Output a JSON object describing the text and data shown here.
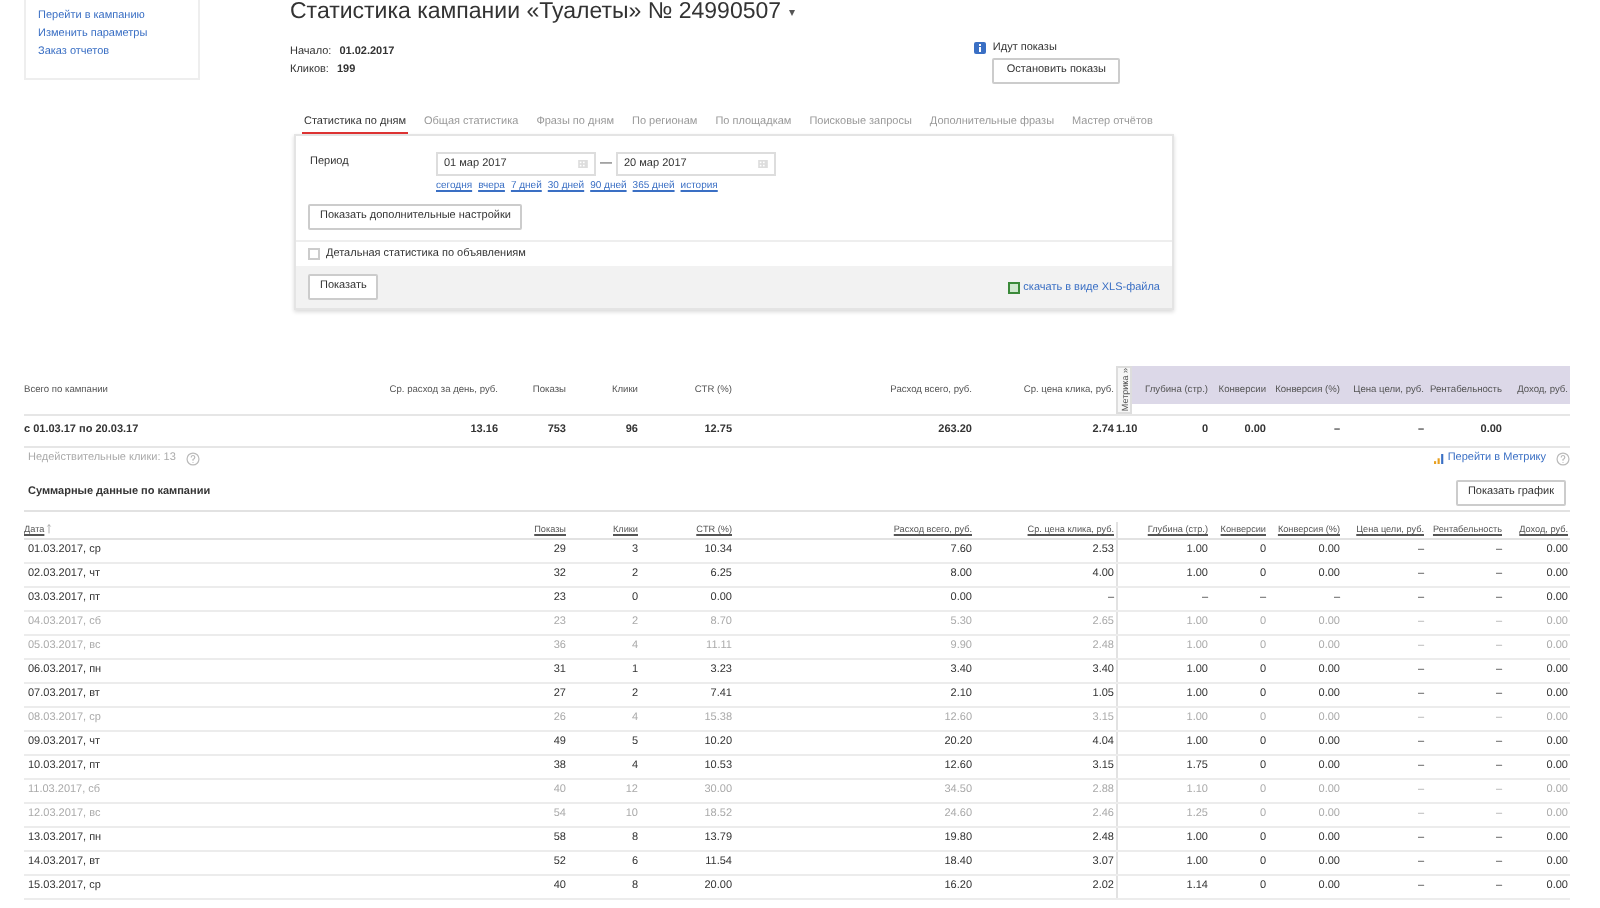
{
  "sidebar": {
    "links": [
      "Перейти в кампанию",
      "Изменить параметры",
      "Заказ отчетов"
    ]
  },
  "title": "Статистика кампании «Туалеты» № 24990507",
  "title_caret": "▾",
  "meta": [
    {
      "label": "Начало:",
      "value": "01.02.2017"
    },
    {
      "label": "Кликов:",
      "value": "199"
    }
  ],
  "status": {
    "text": "Идут показы",
    "button": "Остановить показы"
  },
  "tabs": [
    {
      "label": "Статистика по дням",
      "selected": true
    },
    {
      "label": "Общая статистика",
      "selected": false
    },
    {
      "label": "Фразы по дням",
      "selected": false
    },
    {
      "label": "По регионам",
      "selected": false
    },
    {
      "label": "По площадкам",
      "selected": false
    },
    {
      "label": "Поисковые запросы",
      "selected": false
    },
    {
      "label": "Дополнительные фразы",
      "selected": false
    },
    {
      "label": "Мастер отчётов",
      "selected": false
    }
  ],
  "period": {
    "label": "Период",
    "from": "01 мар 2017",
    "dash": "—",
    "to": "20 мар 2017",
    "quick": [
      "сегодня",
      "вчера",
      "7 дней",
      "30 дней",
      "90 дней",
      "365 дней",
      "история"
    ]
  },
  "settings_button": "Показать дополнительные настройки",
  "detail_checkbox": {
    "label": "Детальная статистика по объявлениям",
    "checked": false
  },
  "show_button": "Показать",
  "xls_link": "скачать в виде XLS-файла",
  "summary": {
    "columns": [
      "Всего по кампании",
      "Ср. расход за день, руб.",
      "Показы",
      "Клики",
      "CTR (%)",
      "Расход всего, руб.",
      "Ср. цена клика, руб.",
      "Глубина (стр.)",
      "Конверсии",
      "Конверсия (%)",
      "Цена цели, руб.",
      "Рентабельность",
      "Доход, руб."
    ],
    "metrica_tab": "Метрика »",
    "values": [
      "с 01.03.17 по 20.03.17",
      "13.16",
      "753",
      "96",
      "12.75",
      "263.20",
      "2.74",
      "1.10",
      "0",
      "0.00",
      "–",
      "–",
      "0.00"
    ]
  },
  "invalid_clicks": "Недействительные клики: 13",
  "metrica_link": "Перейти в Метрику",
  "section_title": "Суммарные данные по кампании",
  "chart_button": "Показать график",
  "table": {
    "columns": [
      "Дата",
      "Показы",
      "Клики",
      "CTR (%)",
      "Расход всего, руб.",
      "Ср. цена клика, руб.",
      "Глубина (стр.)",
      "Конверсии",
      "Конверсия (%)",
      "Цена цели, руб.",
      "Рентабельность",
      "Доход, руб."
    ],
    "rows": [
      {
        "weekend": false,
        "cells": [
          "01.03.2017, ср",
          "29",
          "3",
          "10.34",
          "7.60",
          "2.53",
          "1.00",
          "0",
          "0.00",
          "–",
          "–",
          "0.00"
        ]
      },
      {
        "weekend": false,
        "cells": [
          "02.03.2017, чт",
          "32",
          "2",
          "6.25",
          "8.00",
          "4.00",
          "1.00",
          "0",
          "0.00",
          "–",
          "–",
          "0.00"
        ]
      },
      {
        "weekend": false,
        "cells": [
          "03.03.2017, пт",
          "23",
          "0",
          "0.00",
          "0.00",
          "–",
          "–",
          "–",
          "–",
          "–",
          "–",
          "0.00"
        ]
      },
      {
        "weekend": true,
        "cells": [
          "04.03.2017, сб",
          "23",
          "2",
          "8.70",
          "5.30",
          "2.65",
          "1.00",
          "0",
          "0.00",
          "–",
          "–",
          "0.00"
        ]
      },
      {
        "weekend": true,
        "cells": [
          "05.03.2017, вс",
          "36",
          "4",
          "11.11",
          "9.90",
          "2.48",
          "1.00",
          "0",
          "0.00",
          "–",
          "–",
          "0.00"
        ]
      },
      {
        "weekend": false,
        "cells": [
          "06.03.2017, пн",
          "31",
          "1",
          "3.23",
          "3.40",
          "3.40",
          "1.00",
          "0",
          "0.00",
          "–",
          "–",
          "0.00"
        ]
      },
      {
        "weekend": false,
        "cells": [
          "07.03.2017, вт",
          "27",
          "2",
          "7.41",
          "2.10",
          "1.05",
          "1.00",
          "0",
          "0.00",
          "–",
          "–",
          "0.00"
        ]
      },
      {
        "weekend": true,
        "cells": [
          "08.03.2017, ср",
          "26",
          "4",
          "15.38",
          "12.60",
          "3.15",
          "1.00",
          "0",
          "0.00",
          "–",
          "–",
          "0.00"
        ]
      },
      {
        "weekend": false,
        "cells": [
          "09.03.2017, чт",
          "49",
          "5",
          "10.20",
          "20.20",
          "4.04",
          "1.00",
          "0",
          "0.00",
          "–",
          "–",
          "0.00"
        ]
      },
      {
        "weekend": false,
        "cells": [
          "10.03.2017, пт",
          "38",
          "4",
          "10.53",
          "12.60",
          "3.15",
          "1.75",
          "0",
          "0.00",
          "–",
          "–",
          "0.00"
        ]
      },
      {
        "weekend": true,
        "cells": [
          "11.03.2017, сб",
          "40",
          "12",
          "30.00",
          "34.50",
          "2.88",
          "1.10",
          "0",
          "0.00",
          "–",
          "–",
          "0.00"
        ]
      },
      {
        "weekend": true,
        "cells": [
          "12.03.2017, вс",
          "54",
          "10",
          "18.52",
          "24.60",
          "2.46",
          "1.25",
          "0",
          "0.00",
          "–",
          "–",
          "0.00"
        ]
      },
      {
        "weekend": false,
        "cells": [
          "13.03.2017, пн",
          "58",
          "8",
          "13.79",
          "19.80",
          "2.48",
          "1.00",
          "0",
          "0.00",
          "–",
          "–",
          "0.00"
        ]
      },
      {
        "weekend": false,
        "cells": [
          "14.03.2017, вт",
          "52",
          "6",
          "11.54",
          "18.40",
          "3.07",
          "1.00",
          "0",
          "0.00",
          "–",
          "–",
          "0.00"
        ]
      },
      {
        "weekend": false,
        "cells": [
          "15.03.2017, ср",
          "40",
          "8",
          "20.00",
          "16.20",
          "2.02",
          "1.14",
          "0",
          "0.00",
          "–",
          "–",
          "0.00"
        ]
      }
    ]
  }
}
